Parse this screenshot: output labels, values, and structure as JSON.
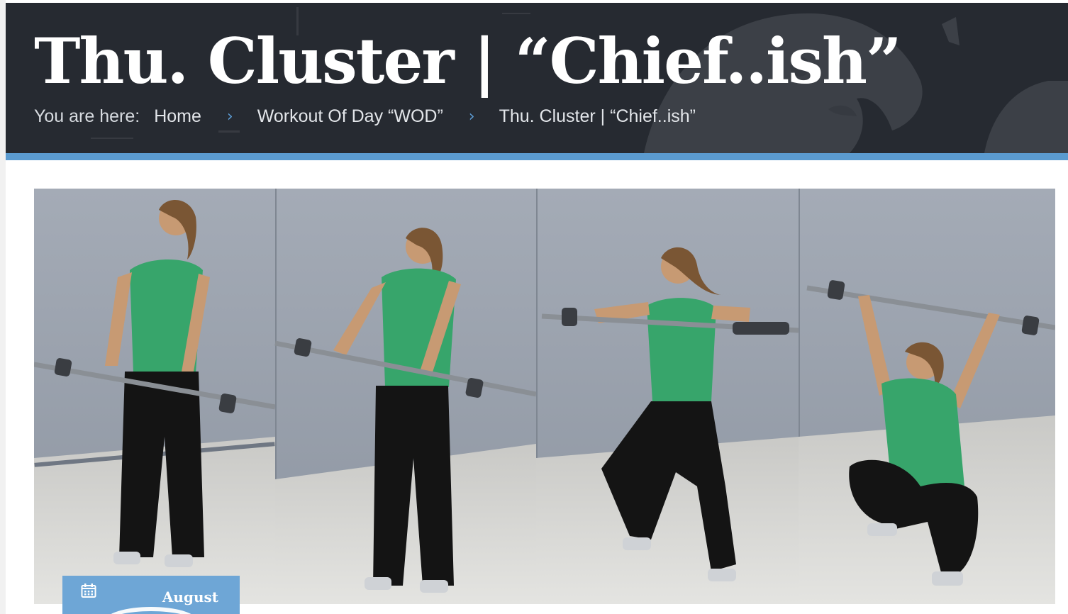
{
  "header": {
    "title": "Thu. Cluster | “Chief..ish”",
    "breadcrumb": {
      "prefix": "You are here:",
      "items": [
        "Home",
        "Workout Of Day “WOD”",
        "Thu. Cluster | “Chief..ish”"
      ],
      "separator": "›"
    }
  },
  "colors": {
    "header_bg": "#262a31",
    "accent": "#5b9bd0",
    "badge_bg": "#6ea6d6"
  },
  "featured_image": {
    "subject": "clean-sequence-photo",
    "frames": 4
  },
  "date_badge": {
    "icon": "calendar-icon",
    "month": "August"
  }
}
